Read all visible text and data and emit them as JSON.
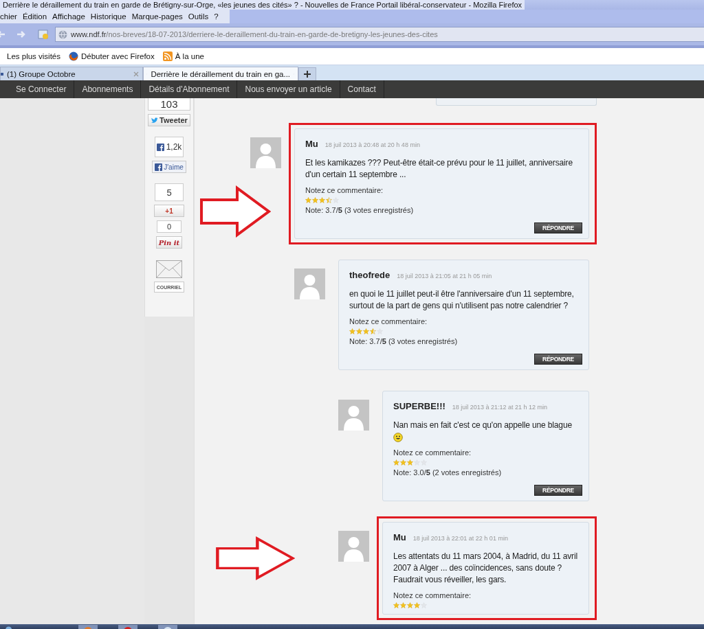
{
  "window": {
    "title": "Derrière le déraillement du train en garde de Brétigny-sur-Orge, «les jeunes des cités» ? - Nouvelles de France Portail libéral-conservateur - Mozilla Firefox"
  },
  "menu": [
    "chier",
    "Édition",
    "Affichage",
    "Historique",
    "Marque-pages",
    "Outils",
    "?"
  ],
  "address_bar": {
    "host": "www.ndf.fr",
    "path": "/nos-breves/18-07-2013/derriere-le-deraillement-du-train-en-garde-de-bretigny-les-jeunes-des-cites"
  },
  "bookmarks": [
    {
      "label": "Les plus visités",
      "kind": "folder"
    },
    {
      "label": "Débuter avec Firefox",
      "kind": "firefox"
    },
    {
      "label": "À la une",
      "kind": "feed"
    }
  ],
  "tabs": [
    {
      "label": "(1) Groupe Octobre",
      "selected": false
    },
    {
      "label": "Derrière le déraillement du train en ga...",
      "selected": true
    }
  ],
  "site_nav": [
    "Se Connecter",
    "Abonnements",
    "Détails d'Abonnement",
    "Nous envoyer un article",
    "Contact"
  ],
  "share_bar": {
    "tweet_count": "103",
    "tweet_button": "Tweeter",
    "like_count": "1,2k",
    "like_button": "J'aime",
    "plusone_count": "5",
    "plusone_button": "+1",
    "pin_count": "0",
    "pin_button": "Pin it",
    "email_button": "COURRIEL"
  },
  "comments": [
    {
      "author": "Mu",
      "date": "18 juil 2013 à 20:48 at 20 h 48 min",
      "text": "Et les kamikazes ??? Peut-être était-ce prévu pour le 11 juillet, anniversaire d'un certain 11 septembre ...",
      "rate_prompt": "Notez ce commentaire:",
      "stars": 3.5,
      "note": "Note: 3.7/**5** (3 votes enregistrés)",
      "reply_button": "RÉPONDRE",
      "highlighted": true,
      "children": [
        {
          "author": "theofrede",
          "date": "18 juil 2013 à 21:05 at 21 h 05 min",
          "text": "en quoi le 11 juillet peut-il être l'anniversaire d'un 11 septembre, surtout de la part de gens qui n'utilisent pas notre calendrier ?",
          "rate_prompt": "Notez ce commentaire:",
          "stars": 3.5,
          "note": "Note: 3.7/**5** (3 votes enregistrés)",
          "reply_button": "RÉPONDRE",
          "highlighted": false,
          "children": [
            {
              "author": "SUPERBE!!!",
              "date": "18 juil 2013 à 21:12 at 21 h 12 min",
              "text": "Nan mais en fait c'est ce qu'on appelle une blague",
              "smiley": true,
              "rate_prompt": "Notez ce commentaire:",
              "stars": 3,
              "note": "Note: 3.0/**5** (2 votes enregistrés)",
              "reply_button": "RÉPONDRE",
              "highlighted": false
            },
            {
              "author": "Mu",
              "date": "18 juil 2013 à 22:01 at 22 h 01 min",
              "text": "Les attentats du 11 mars 2004, à Madrid, du 11 avril 2007 à Alger ... des coïncidences, sans doute ? Faudrait vous réveiller, les gars.",
              "smiley": false,
              "rate_prompt": "Notez ce commentaire:",
              "stars": 4,
              "highlighted": true
            }
          ]
        }
      ]
    }
  ]
}
